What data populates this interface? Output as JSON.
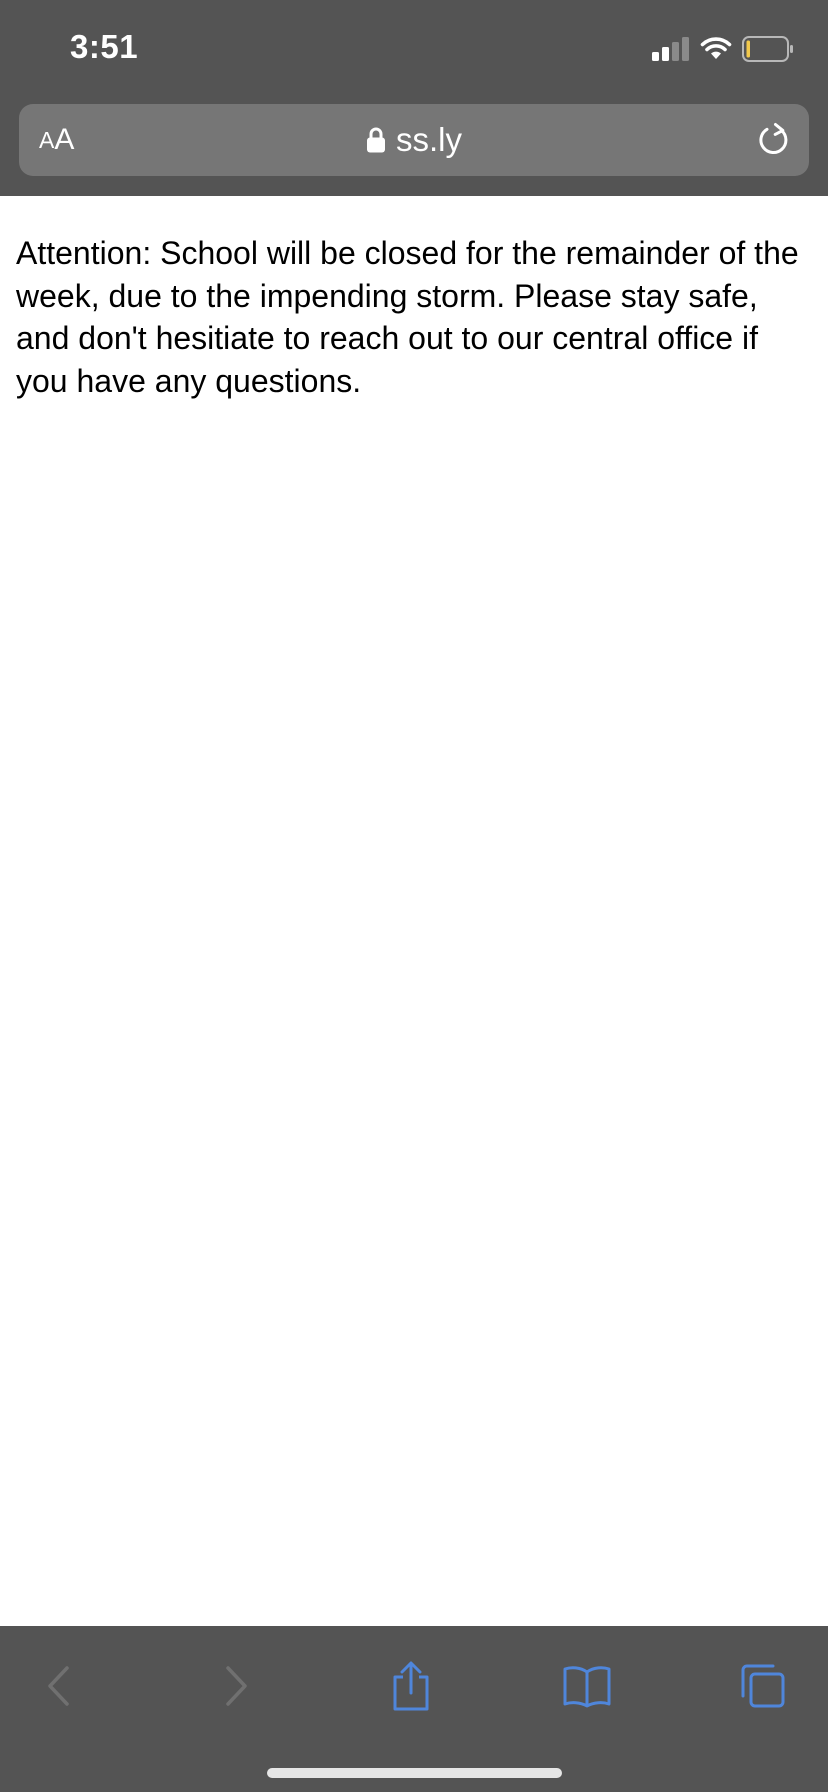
{
  "status_bar": {
    "time": "3:51",
    "icons": [
      "cellular-signal-icon",
      "wifi-icon",
      "battery-icon"
    ]
  },
  "address_bar": {
    "text_size_button": {
      "small": "A",
      "large": "A"
    },
    "lock_icon": "lock-icon",
    "url": "ss.ly",
    "reload_icon": "reload-icon"
  },
  "page": {
    "message": "Attention: School will be closed for the remainder of the week, due to the impending storm. Please stay safe, and don't hesitiate to reach out to our central office if you have any questions."
  },
  "toolbar": {
    "buttons": [
      "back-icon",
      "forward-icon",
      "share-icon",
      "bookmarks-icon",
      "tabs-icon"
    ]
  },
  "colors": {
    "chrome": "#545454",
    "address_field": "#767676",
    "accent_blue": "#4f86db",
    "disabled_gray": "#707070",
    "battery_level": "#f2c94c"
  }
}
